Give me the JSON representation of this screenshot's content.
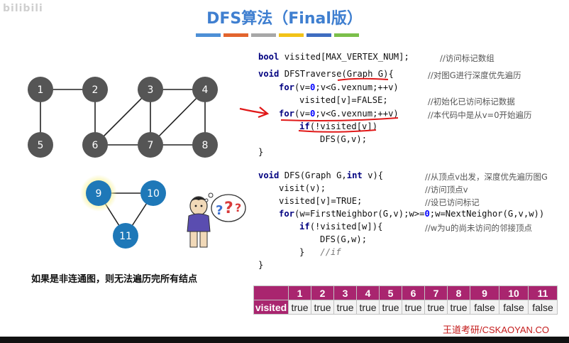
{
  "watermark": "bilibili",
  "title": "DFS算法（Final版）",
  "stripe_colors": [
    "#4d8fd6",
    "#e2642e",
    "#a7a7a7",
    "#f2c318",
    "#3f6dc0",
    "#7bbf4a"
  ],
  "graph1": {
    "nodes": [
      "1",
      "2",
      "3",
      "4",
      "5",
      "6",
      "7",
      "8"
    ],
    "node_color": "#555555"
  },
  "graph2": {
    "nodes": [
      "9",
      "10",
      "11"
    ],
    "node_color": "#1e78b8"
  },
  "caption": "如果是非连通图，则无法遍历完所有结点",
  "code": {
    "l1_kw": "bool",
    "l1": " visited[MAX_VERTEX_NUM];",
    "l1_cm": "//访问标记数组",
    "l2_kw": "void",
    "l2": " DFSTraverse(Graph G){",
    "l2_cm": "//对图G进行深度优先遍历",
    "l3_kw": "for",
    "l3_a": "(v=",
    "l3_n": "0",
    "l3_b": ";v<G.vexnum;++v)",
    "l4": "visited[v]=FALSE;",
    "l4_cm": "//初始化已访问标记数据",
    "l5_kw": "for",
    "l5_a": "(v=",
    "l5_n": "0",
    "l5_b": ";v<G.vexnum;++v)",
    "l5_cm": "//本代码中是从v=0开始遍历",
    "l6_kw": "if",
    "l6": "(!visited[v])",
    "l7": "DFS(G,v);",
    "l8": "}",
    "l9_kw": "void",
    "l9_a": " DFS(Graph G,",
    "l9_kw2": "int",
    "l9_b": " v){",
    "l9_cm": "//从顶点v出发，深度优先遍历图G",
    "l10": "visit(v);",
    "l10_cm": "//访问顶点v",
    "l11": "visited[v]=TRUE;",
    "l11_cm": "//设已访问标记",
    "l12_kw": "for",
    "l12_a": "(w=FirstNeighbor(G,v);w>=",
    "l12_n": "0",
    "l12_b": ";w=NextNeighor(G,v,w))",
    "l13_kw": "if",
    "l13": "(!visited[w]){",
    "l13_cm": "//w为u的尚未访问的邻接顶点",
    "l14": "DFS(G,w);",
    "l15": "}",
    "l15_cm": "//if",
    "l16": "}"
  },
  "visited_table": {
    "label": "visited",
    "headers": [
      "1",
      "2",
      "3",
      "4",
      "5",
      "6",
      "7",
      "8",
      "9",
      "10",
      "11"
    ],
    "values": [
      "true",
      "true",
      "true",
      "true",
      "true",
      "true",
      "true",
      "true",
      "false",
      "false",
      "false"
    ]
  },
  "brand": "王道考研/CSKAOYAN.CO"
}
